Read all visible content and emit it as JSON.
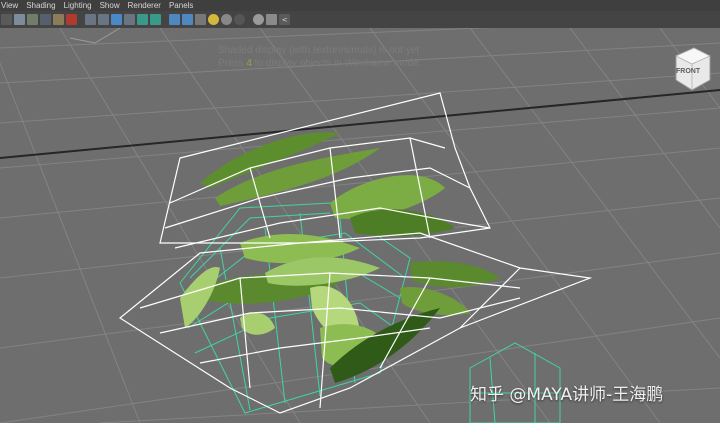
{
  "menubar": {
    "items": [
      "View",
      "Shading",
      "Lighting",
      "Show",
      "Renderer",
      "Panels"
    ]
  },
  "toolbar": {
    "icons": [
      "camera-select-icon",
      "camera-attr-icon",
      "bookmark-icon",
      "image-plane-icon",
      "grid-toggle-icon",
      "film-gate-icon",
      "resolution-gate-icon",
      "gate-mask-icon",
      "field-chart-icon",
      "safe-action-icon",
      "safe-title-icon",
      "wireframe-icon",
      "smooth-shade-icon",
      "textured-icon",
      "default-light-icon",
      "shadows-icon",
      "xray-icon",
      "isolate-icon",
      "sphere-icon",
      "cube-icon",
      "share-icon"
    ]
  },
  "viewport": {
    "message_line1": "Shaded display (with textures/mats) is not yet",
    "message_line2_pre": "Press ",
    "message_line2_key": "4",
    "message_line2_post": " to display objects in Wireframe mode.",
    "viewcube_label": "FRONT",
    "accent_color": "#a39c48",
    "grid_color": "#8a8a8a",
    "wire_color": "#ffffff",
    "selection_wire_color": "#3fd6a0"
  },
  "watermark": {
    "text": "知乎 @MAYA讲师-王海鹏"
  }
}
